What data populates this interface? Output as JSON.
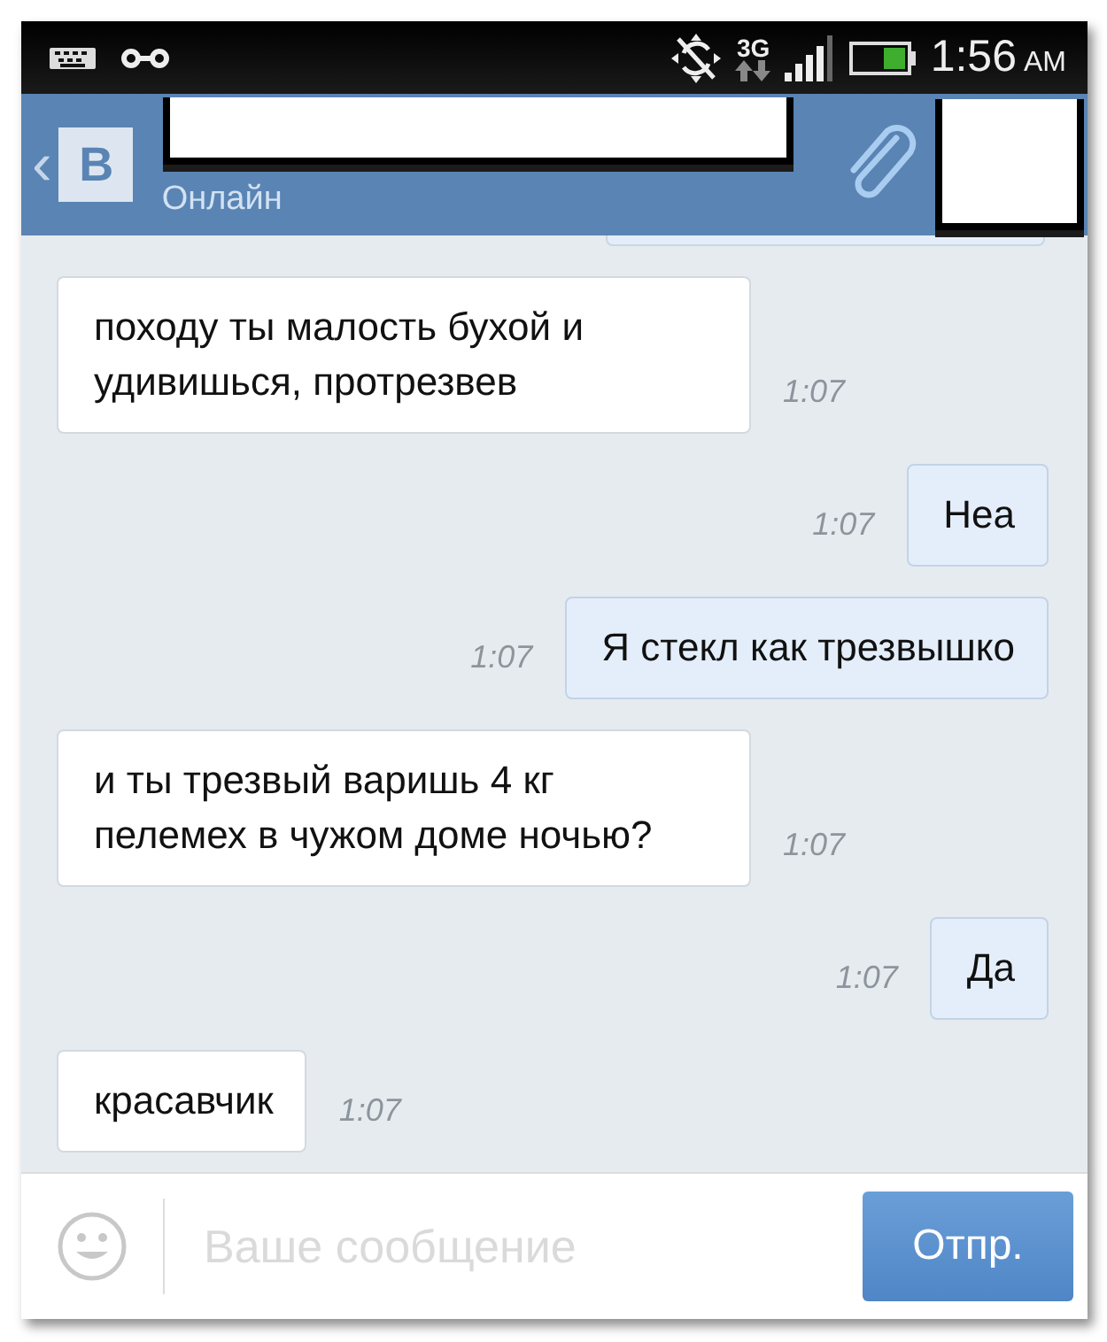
{
  "status_bar": {
    "network": "3G",
    "time": "1:56",
    "period": "AM"
  },
  "header": {
    "back": "‹",
    "logo": "В",
    "subtitle": "Онлайн"
  },
  "messages": [
    {
      "kind": "incoming",
      "text": "походу ты малость бухой и удивишься, протрезвев",
      "time": "1:07"
    },
    {
      "kind": "outgoing",
      "text": "Неа",
      "time": "1:07"
    },
    {
      "kind": "outgoing",
      "text": "Я стекл как трезвышко",
      "time": "1:07"
    },
    {
      "kind": "incoming",
      "text": "и ты трезвый варишь 4 кг пелемех в чужом доме ночью?",
      "time": "1:07"
    },
    {
      "kind": "outgoing",
      "text": "Да",
      "time": "1:07"
    },
    {
      "kind": "incoming",
      "text": "красавчик",
      "time": "1:07"
    }
  ],
  "composer": {
    "placeholder": "Ваше сообщение",
    "send": "Отпр."
  }
}
